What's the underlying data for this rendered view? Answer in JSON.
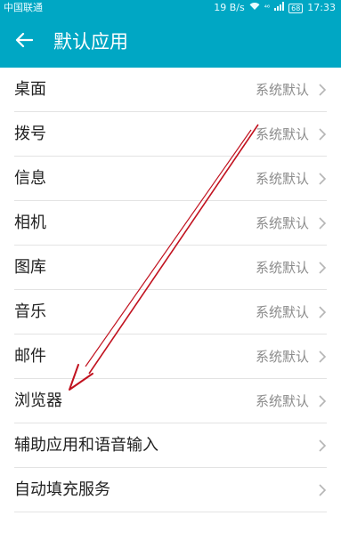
{
  "status_bar": {
    "carrier": "中国联通",
    "net_speed": "19 B/s",
    "signal_label": "⁴⁶",
    "battery": "68",
    "time": "17:33"
  },
  "header": {
    "title": "默认应用",
    "back_icon": "arrow-left-icon"
  },
  "items": [
    {
      "label": "桌面",
      "value": "系统默认"
    },
    {
      "label": "拨号",
      "value": "系统默认"
    },
    {
      "label": "信息",
      "value": "系统默认"
    },
    {
      "label": "相机",
      "value": "系统默认"
    },
    {
      "label": "图库",
      "value": "系统默认"
    },
    {
      "label": "音乐",
      "value": "系统默认"
    },
    {
      "label": "邮件",
      "value": "系统默认"
    },
    {
      "label": "浏览器",
      "value": "系统默认"
    },
    {
      "label": "辅助应用和语音输入",
      "value": ""
    },
    {
      "label": "自动填充服务",
      "value": ""
    }
  ],
  "colors": {
    "accent": "#00a7c4",
    "annotation_arrow": "#c1121f"
  }
}
